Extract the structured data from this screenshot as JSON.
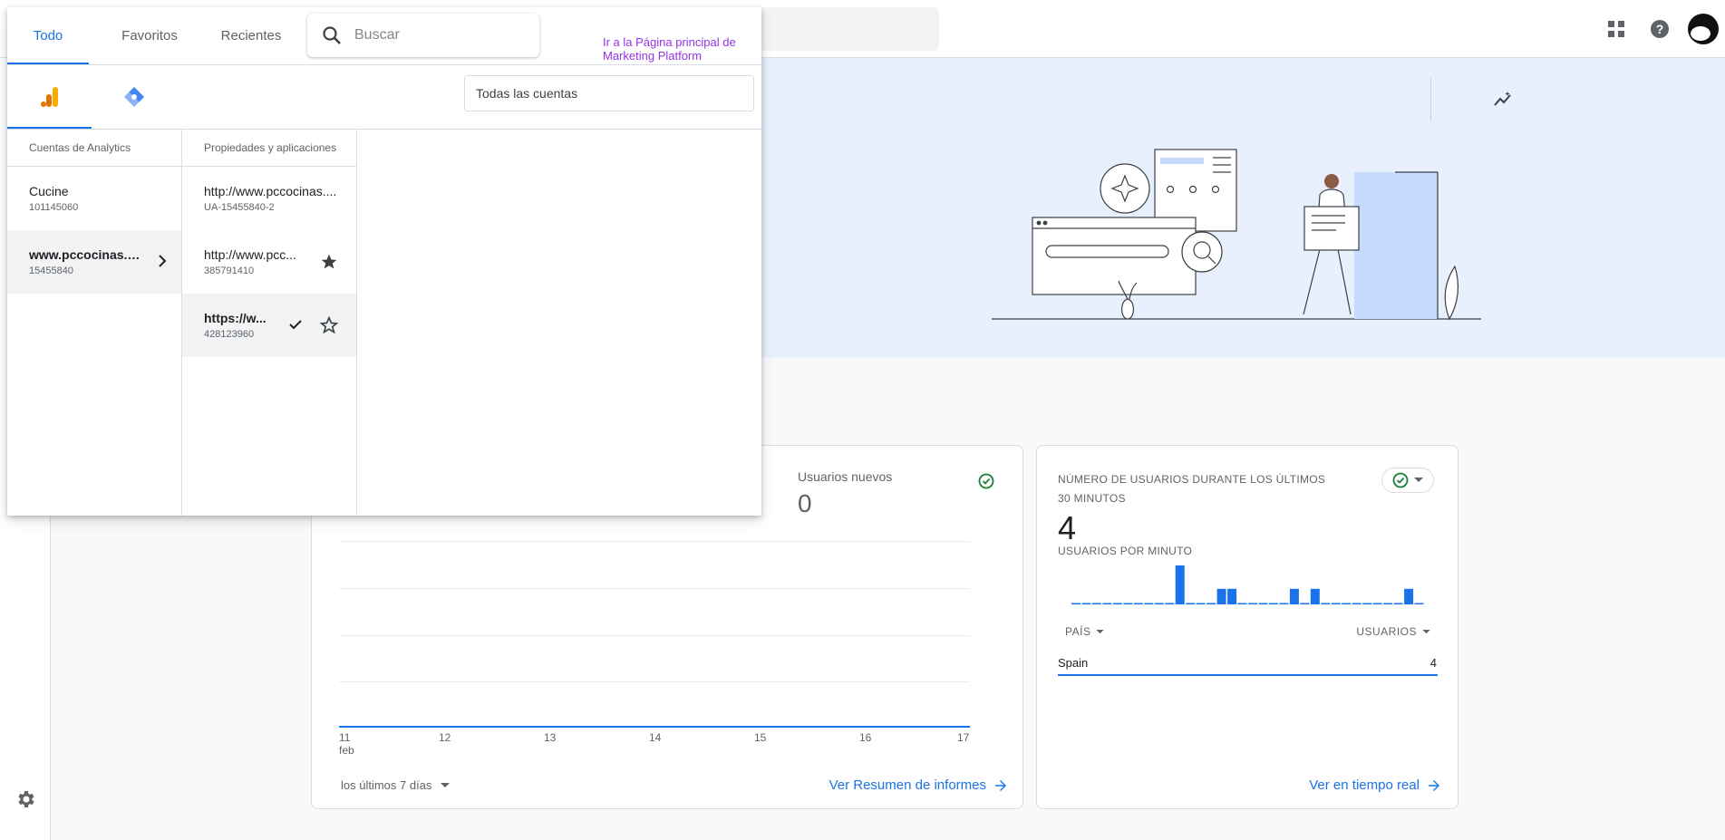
{
  "picker": {
    "tabs": [
      {
        "label": "Todo"
      },
      {
        "label": "Favoritos"
      },
      {
        "label": "Recientes"
      }
    ],
    "search": {
      "placeholder": "Buscar",
      "value": ""
    },
    "marketing_link": "Ir a la Página principal de Marketing Platform",
    "product_tabs": [
      {
        "icon": "analytics-icon",
        "active": true
      },
      {
        "icon": "tag-manager-icon",
        "active": false
      }
    ],
    "account_filter": "Todas las cuentas",
    "accounts_header": "Cuentas de Analytics",
    "properties_header": "Propiedades y aplicaciones",
    "accounts": [
      {
        "name": "Cucine",
        "id": "101145060"
      },
      {
        "name": "www.pccocinas.c...",
        "id": "15455840"
      }
    ],
    "properties": [
      {
        "name": "http://www.pccocinas....",
        "id": "UA-15455840-2"
      },
      {
        "name": "http://www.pcc...",
        "id": "385791410"
      },
      {
        "name": "https://w...",
        "id": "428123960"
      }
    ]
  },
  "overview": {
    "metric_label": "Usuarios nuevos",
    "metric_value": "0",
    "x_ticks": [
      "11",
      "12",
      "13",
      "14",
      "15",
      "16",
      "17"
    ],
    "x_sub": "feb",
    "range": "los últimos 7 días",
    "link": "Ver Resumen de informes"
  },
  "realtime": {
    "title": "NÚMERO DE USUARIOS DURANTE LOS ÚLTIMOS 30 MINUTOS",
    "value": "4",
    "subtitle": "USUARIOS POR MINUTO",
    "per_minute": [
      0,
      0,
      0,
      0,
      0,
      0,
      0,
      0,
      0,
      0,
      1,
      0,
      0,
      0,
      0.4,
      0.4,
      0,
      0,
      0,
      0,
      0,
      0.4,
      0,
      0.4,
      0,
      0,
      0,
      0,
      0,
      0,
      0,
      0,
      0.4,
      0
    ],
    "col_country": "PAÍS",
    "col_users": "USUARIOS",
    "rows": [
      {
        "country": "Spain",
        "users": "4"
      }
    ],
    "link": "Ver en tiempo real"
  },
  "colors": {
    "accent": "#1a73e8",
    "hero_bg": "#e8f0fe",
    "link_purple": "#9334e6"
  }
}
